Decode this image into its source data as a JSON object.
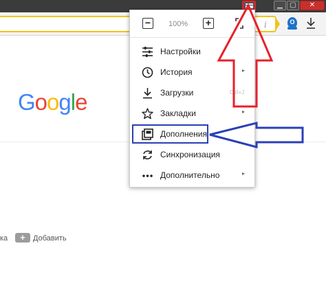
{
  "titlebar": {
    "menu_icon": "hamburger-icon",
    "minimize_glyph": "▁",
    "maximize_glyph": "▢",
    "close_glyph": "✕"
  },
  "toolbar": {
    "info_glyph": "i",
    "extension_glyph": "O",
    "download_icon": "download-icon"
  },
  "page": {
    "logo": [
      "G",
      "o",
      "o",
      "g",
      "l",
      "e"
    ],
    "bottom_left_text": "ка",
    "add_button_glyph": "+",
    "add_label": "Добавить"
  },
  "menu": {
    "zoom": {
      "minus": "−",
      "value": "100%",
      "plus": "+"
    },
    "items": [
      {
        "label": "Настройки",
        "icon": "settings-sliders-icon",
        "submenu": false,
        "hint": ""
      },
      {
        "label": "История",
        "icon": "clock-icon",
        "submenu": true,
        "hint": ""
      },
      {
        "label": "Загрузки",
        "icon": "download-icon",
        "submenu": false,
        "hint": "Ctrl+J"
      },
      {
        "label": "Закладки",
        "icon": "star-icon",
        "submenu": true,
        "hint": ""
      },
      {
        "label": "Дополнения",
        "icon": "addons-icon",
        "submenu": false,
        "hint": ""
      },
      {
        "label": "Синхронизация",
        "icon": "sync-icon",
        "submenu": false,
        "hint": ""
      },
      {
        "label": "Дополнительно",
        "icon": "more-dots-icon",
        "submenu": true,
        "hint": ""
      }
    ],
    "submenu_glyph": "▸"
  },
  "colors": {
    "highlight_red": "#e8202a",
    "highlight_blue": "#2b3fb8",
    "address_yellow": "#f0c419"
  }
}
